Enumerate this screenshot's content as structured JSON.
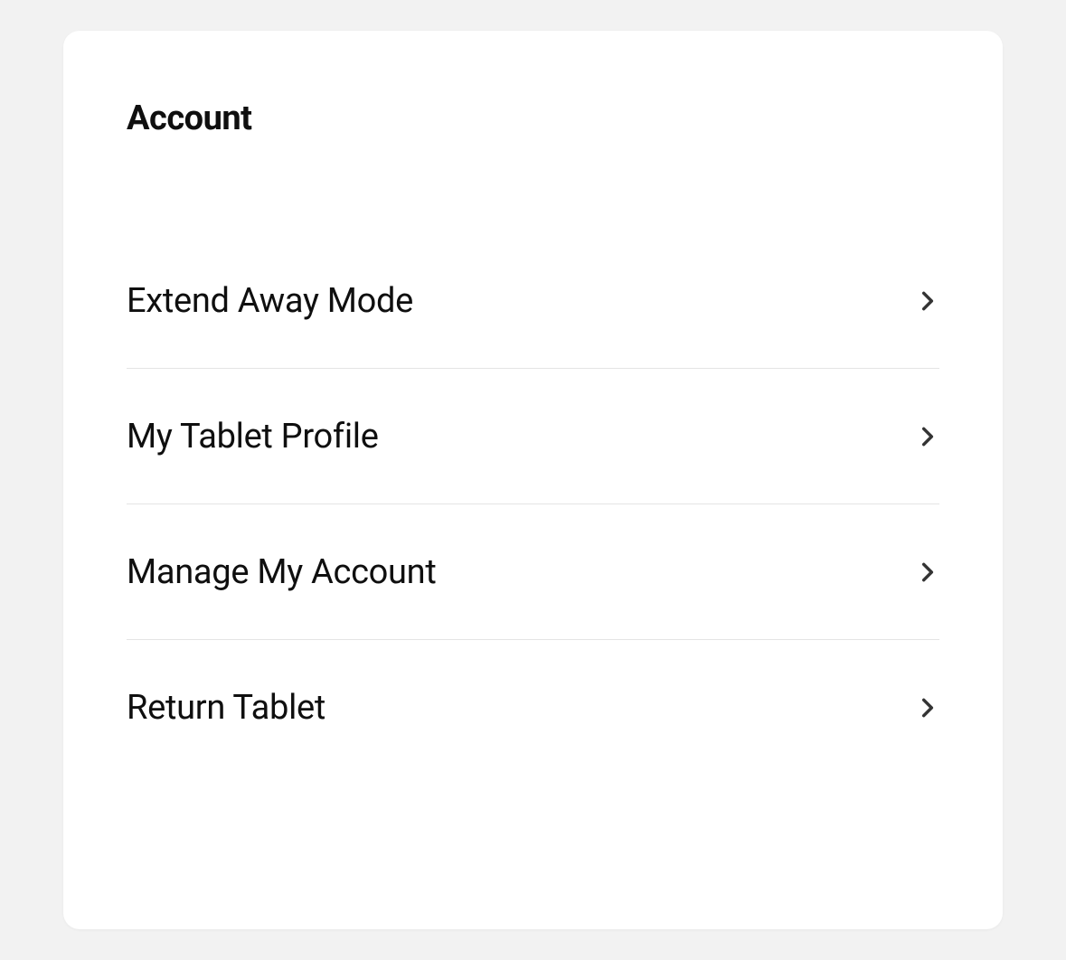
{
  "section": {
    "title": "Account",
    "items": [
      {
        "label": "Extend Away Mode"
      },
      {
        "label": "My Tablet Profile"
      },
      {
        "label": "Manage My Account"
      },
      {
        "label": "Return Tablet"
      }
    ]
  }
}
